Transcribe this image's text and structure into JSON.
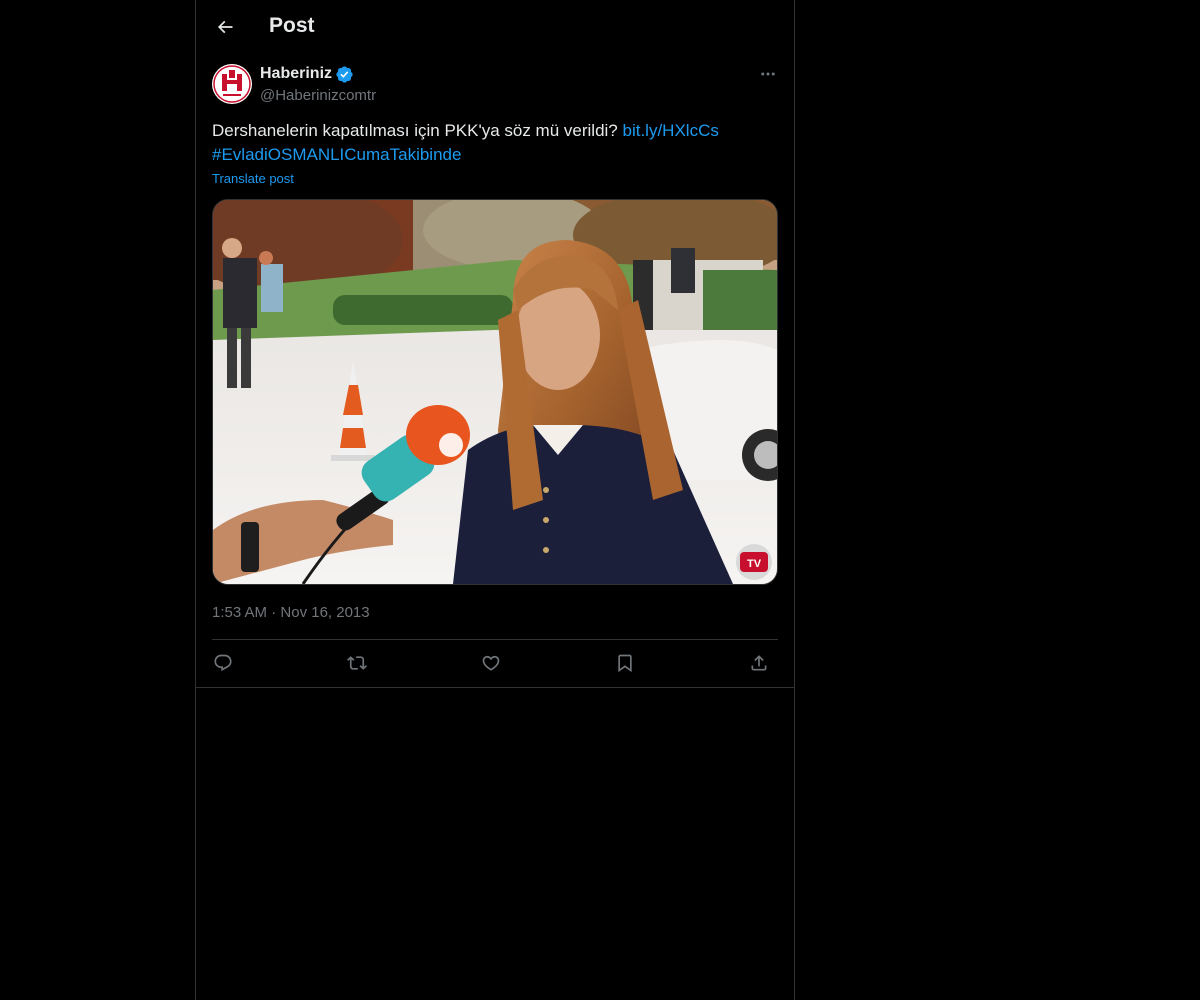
{
  "header": {
    "title": "Post",
    "back_icon": "arrow-left-icon"
  },
  "author": {
    "display_name": "Haberiniz",
    "handle": "@Haberinizcomtr",
    "verified": true,
    "verified_color": "#1d9bf0",
    "avatar_text": "HABERİNİZ",
    "avatar_brand_color": "#c8102e"
  },
  "post": {
    "text": "Dershanelerin kapatılması için PKK'ya söz mü verildi?",
    "link": "bit.ly/HXlcCs",
    "hashtag": "#EvladiOSMANLICumaTakibinde",
    "translate_label": "Translate post",
    "time": "1:53 AM",
    "separator": "·",
    "date": "Nov 16, 2013",
    "media_badge": "TV"
  },
  "actions": {
    "reply": "reply-icon",
    "repost": "repost-icon",
    "like": "like-icon",
    "bookmark": "bookmark-icon",
    "share": "share-icon"
  },
  "colors": {
    "background": "#000000",
    "text": "#e7e9ea",
    "muted": "#71767b",
    "accent": "#1d9bf0",
    "border": "#2f3336"
  }
}
